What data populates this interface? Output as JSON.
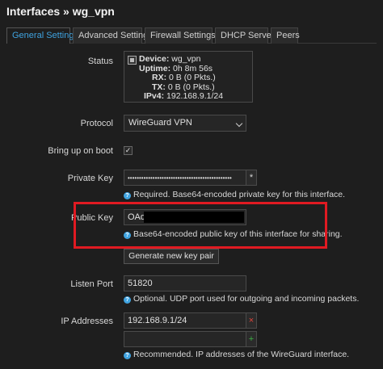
{
  "header": {
    "title": "Interfaces » wg_vpn"
  },
  "tabs": [
    {
      "label": "General Settings",
      "active": true
    },
    {
      "label": "Advanced Settings",
      "active": false
    },
    {
      "label": "Firewall Settings",
      "active": false
    },
    {
      "label": "DHCP Server",
      "active": false
    },
    {
      "label": "Peers",
      "active": false
    }
  ],
  "status": {
    "label": "Status",
    "device_label": "Device:",
    "device_value": "wg_vpn",
    "uptime_label": "Uptime:",
    "uptime_value": "0h 8m 56s",
    "rx_label": "RX:",
    "rx_value": "0 B (0 Pkts.)",
    "tx_label": "TX:",
    "tx_value": "0 B (0 Pkts.)",
    "ipv4_label": "IPv4:",
    "ipv4_value": "192.168.9.1/24"
  },
  "protocol": {
    "label": "Protocol",
    "value": "WireGuard VPN"
  },
  "bring_up": {
    "label": "Bring up on boot",
    "checked": true,
    "check_glyph": "✓"
  },
  "private_key": {
    "label": "Private Key",
    "value": "••••••••••••••••••••••••••••••••••••••••••••••",
    "reveal_glyph": "*",
    "hint": "Required. Base64-encoded private key for this interface."
  },
  "public_key": {
    "label": "Public Key",
    "value": "OAq",
    "hint": "Base64-encoded public key of this interface for sharing."
  },
  "generate_button": {
    "label": "Generate new key pair"
  },
  "listen_port": {
    "label": "Listen Port",
    "value": "51820",
    "hint": "Optional. UDP port used for outgoing and incoming packets."
  },
  "ip_addresses": {
    "label": "IP Addresses",
    "values": [
      "192.168.9.1/24",
      ""
    ],
    "remove_glyph": "×",
    "add_glyph": "+",
    "hint": "Recommended. IP addresses of the WireGuard interface."
  },
  "colors": {
    "accent": "#3fa3e0",
    "highlight": "#e01a22",
    "remove": "#e0443a",
    "add": "#3cb043"
  },
  "icons": {
    "hint": "question-icon",
    "status": "network-device-icon"
  },
  "hint_glyph": "?"
}
